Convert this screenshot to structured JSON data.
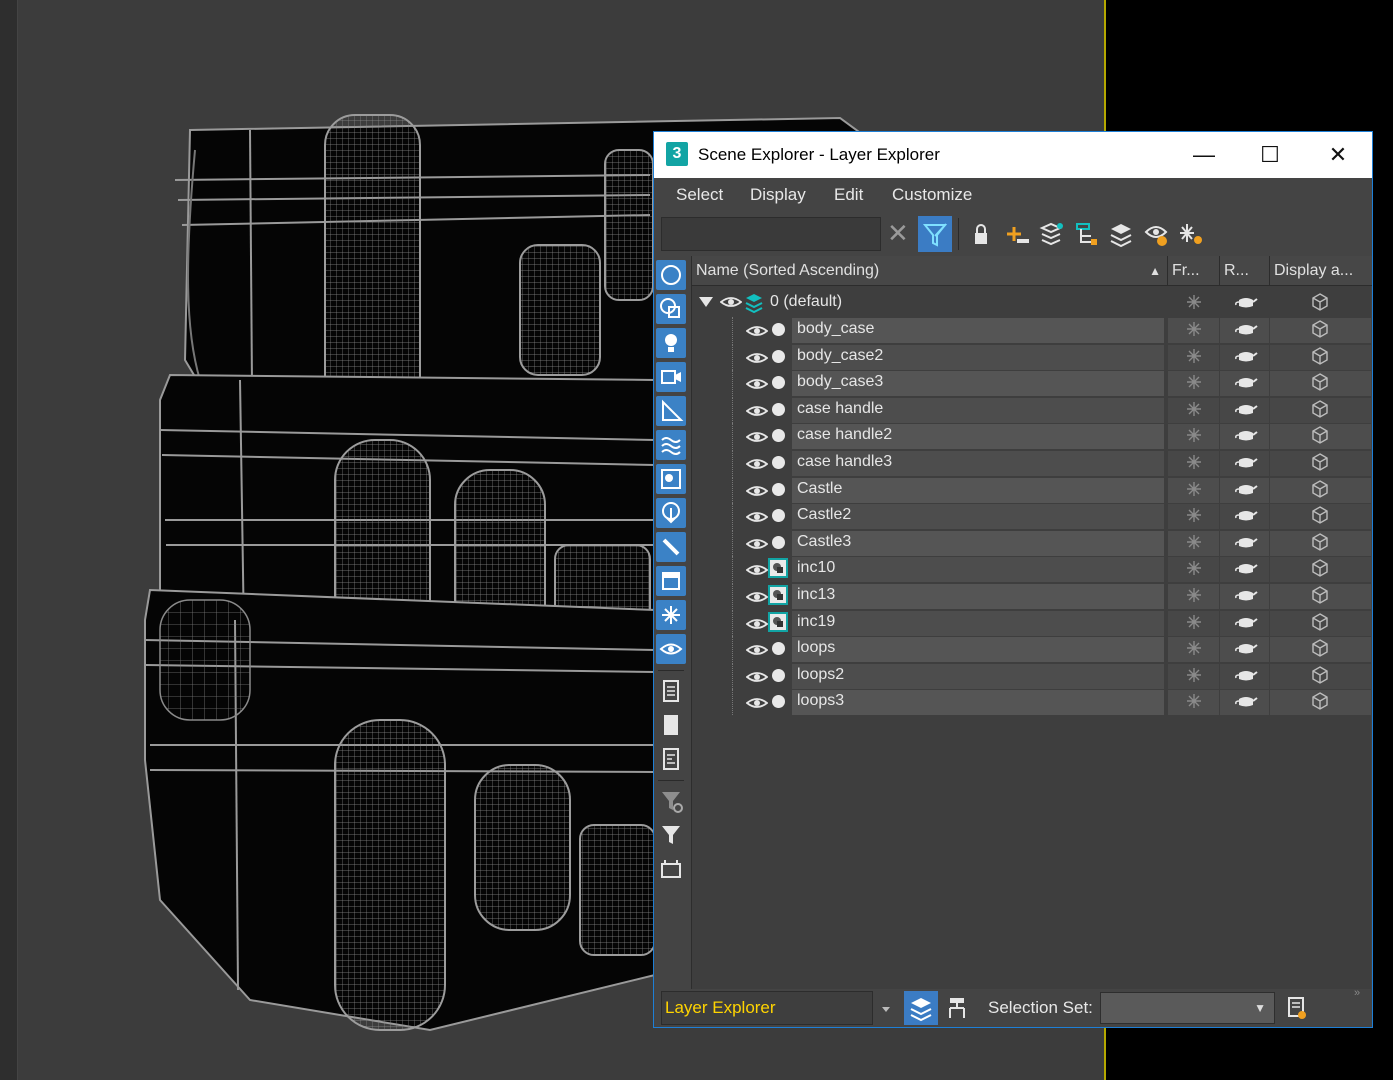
{
  "window": {
    "app_icon": "3",
    "title": "Scene Explorer - Layer Explorer",
    "minimize": "—",
    "maximize": "☐",
    "close": "✕"
  },
  "menu": [
    "Select",
    "Display",
    "Edit",
    "Customize"
  ],
  "search": {
    "value": "",
    "placeholder": ""
  },
  "columns": {
    "name": "Name (Sorted Ascending)",
    "sort_arrow": "▲",
    "frozen": "Fr...",
    "render": "R...",
    "display": "Display a..."
  },
  "layer": {
    "label": "0 (default)"
  },
  "objects": [
    {
      "name": "body_case",
      "type": "mesh"
    },
    {
      "name": "body_case2",
      "type": "mesh"
    },
    {
      "name": "body_case3",
      "type": "mesh"
    },
    {
      "name": "case handle",
      "type": "mesh"
    },
    {
      "name": "case handle2",
      "type": "mesh"
    },
    {
      "name": "case handle3",
      "type": "mesh"
    },
    {
      "name": "Castle",
      "type": "mesh"
    },
    {
      "name": "Castle2",
      "type": "mesh"
    },
    {
      "name": "Castle3",
      "type": "mesh"
    },
    {
      "name": "inc10",
      "type": "group"
    },
    {
      "name": "inc13",
      "type": "group"
    },
    {
      "name": "inc19",
      "type": "group"
    },
    {
      "name": "loops",
      "type": "mesh"
    },
    {
      "name": "loops2",
      "type": "mesh"
    },
    {
      "name": "loops3",
      "type": "mesh"
    }
  ],
  "bottom": {
    "explorer_name": "Layer Explorer",
    "selection_set_label": "Selection Set:",
    "selection_set_value": ""
  },
  "colors": {
    "accent": "#3b7cc4",
    "teal": "#12a4a4",
    "highlight_text": "#ffd400",
    "viewport_border": "#b5a800"
  }
}
